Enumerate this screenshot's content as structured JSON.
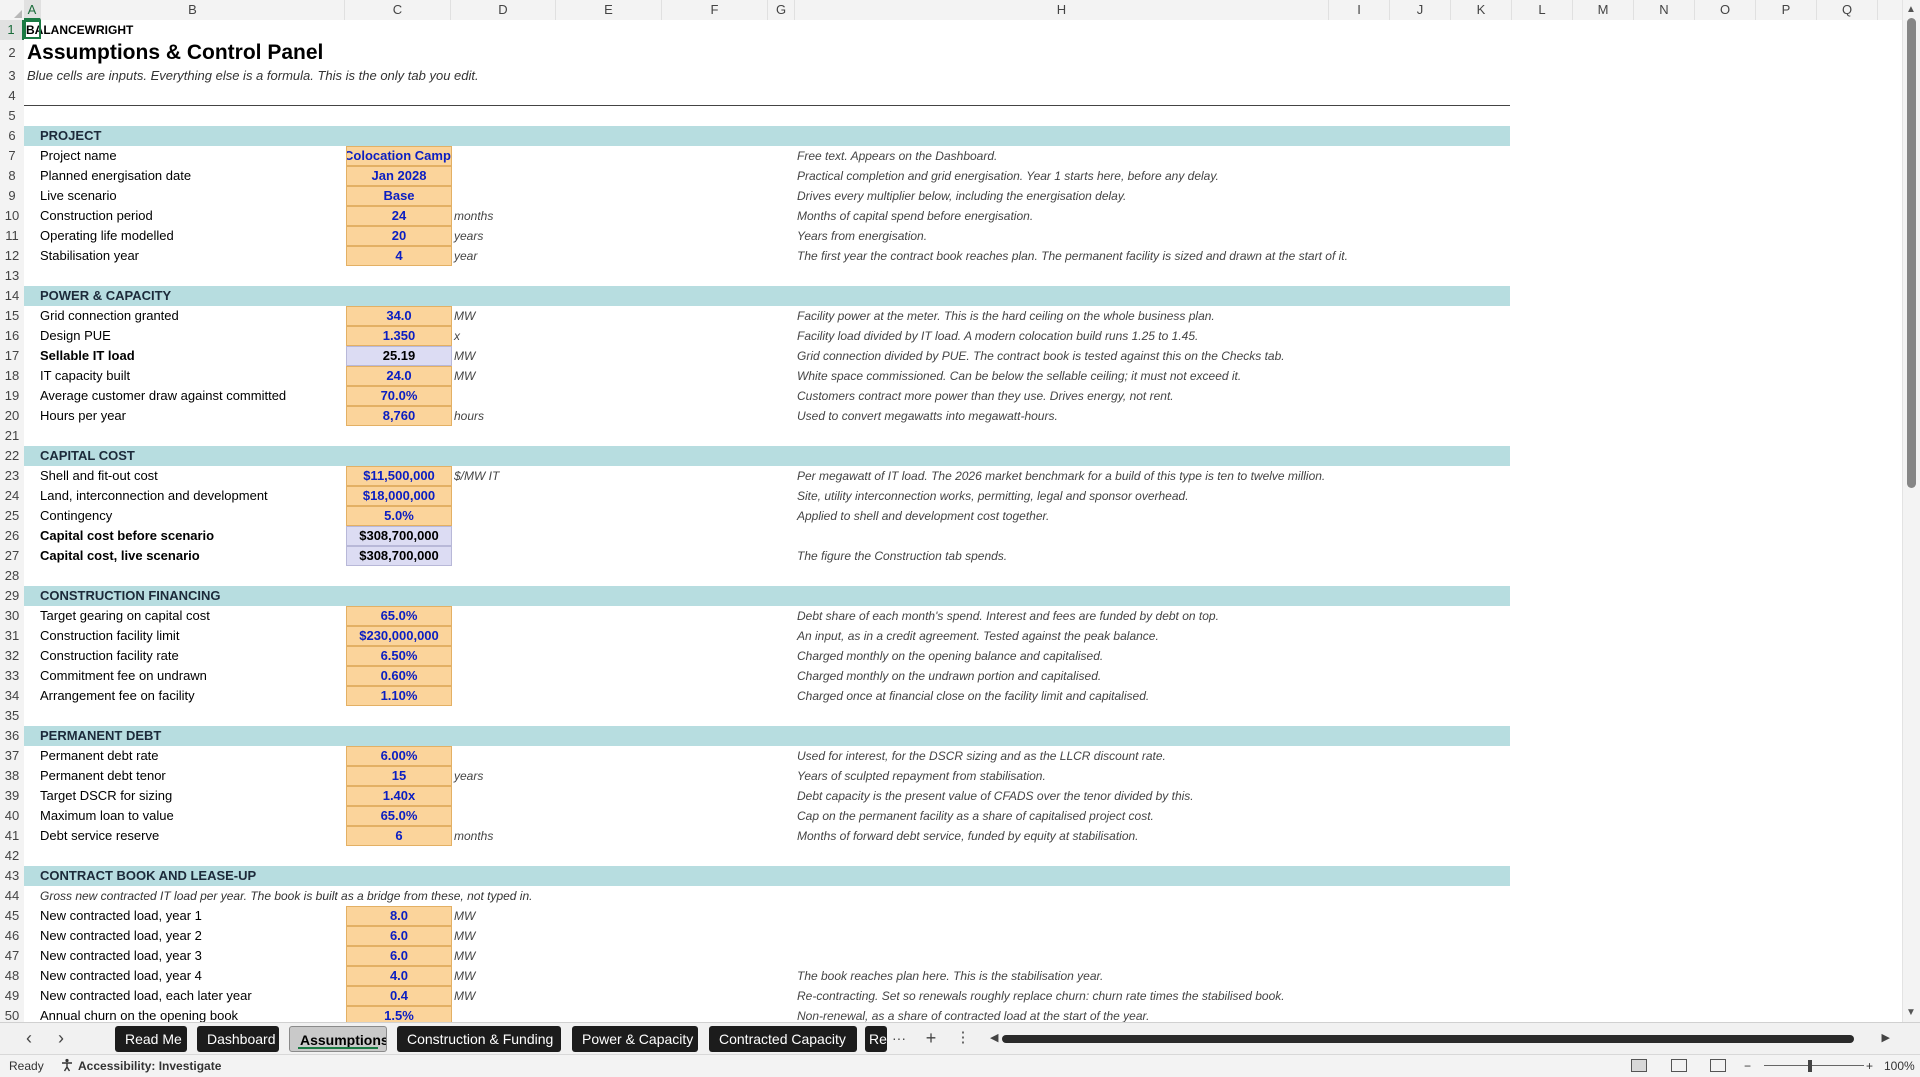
{
  "columns": [
    "A",
    "B",
    "C",
    "D",
    "E",
    "F",
    "G",
    "H",
    "I",
    "J",
    "K",
    "L",
    "M",
    "N",
    "O",
    "P",
    "Q"
  ],
  "active_column": "A",
  "active_row": "1",
  "rows": [
    "1",
    "2",
    "3",
    "4",
    "5",
    "6",
    "7",
    "8",
    "9",
    "10",
    "11",
    "12",
    "13",
    "14",
    "15",
    "16",
    "17",
    "18",
    "19",
    "20",
    "21",
    "22",
    "23",
    "24",
    "25",
    "26",
    "27",
    "28",
    "29",
    "30",
    "31",
    "32",
    "33",
    "34",
    "35",
    "36",
    "37",
    "38",
    "39",
    "40",
    "41",
    "42",
    "43",
    "44",
    "45",
    "46",
    "47",
    "48",
    "49",
    "50"
  ],
  "header": {
    "brand": "BALANCEWRIGHT",
    "title": "Assumptions & Control Panel",
    "subtitle": "Blue cells are inputs. Everything else is a formula. This is the only tab you edit."
  },
  "sections": {
    "project": "PROJECT",
    "power": "POWER & CAPACITY",
    "capital": "CAPITAL COST",
    "construction": "CONSTRUCTION FINANCING",
    "permanent": "PERMANENT DEBT",
    "contract": "CONTRACT BOOK AND LEASE-UP"
  },
  "contract_note": "Gross new contracted IT load per year. The book is built as a bridge from these, not typed in.",
  "lines": {
    "r7": {
      "label": "Project name",
      "value": "Colocation Campus - Phase I",
      "unit": "",
      "note": "Free text. Appears on the Dashboard."
    },
    "r8": {
      "label": "Planned energisation date",
      "value": "Jan 2028",
      "unit": "",
      "note": "Practical completion and grid energisation. Year 1 starts here, before any delay."
    },
    "r9": {
      "label": "Live scenario",
      "value": "Base",
      "unit": "",
      "note": "Drives every multiplier below, including the energisation delay."
    },
    "r10": {
      "label": "Construction period",
      "value": "24",
      "unit": "months",
      "note": "Months of capital spend before energisation."
    },
    "r11": {
      "label": "Operating life modelled",
      "value": "20",
      "unit": "years",
      "note": "Years from energisation."
    },
    "r12": {
      "label": "Stabilisation year",
      "value": "4",
      "unit": "year",
      "note": "The first year the contract book reaches plan. The permanent facility is sized and drawn at the start of it."
    },
    "r15": {
      "label": "Grid connection granted",
      "value": "34.0",
      "unit": "MW",
      "note": "Facility power at the meter. This is the hard ceiling on the whole business plan."
    },
    "r16": {
      "label": "Design PUE",
      "value": "1.350",
      "unit": "x",
      "note": "Facility load divided by IT load. A modern colocation build runs 1.25 to 1.45."
    },
    "r17": {
      "label": "Sellable IT load",
      "value": "25.19",
      "unit": "MW",
      "note": "Grid connection divided by PUE. The contract book is tested against this on the Checks tab."
    },
    "r18": {
      "label": "IT capacity built",
      "value": "24.0",
      "unit": "MW",
      "note": "White space commissioned. Can be below the sellable ceiling; it must not exceed it."
    },
    "r19": {
      "label": "Average customer draw against committed",
      "value": "70.0%",
      "unit": "",
      "note": "Customers contract more power than they use. Drives energy, not rent."
    },
    "r20": {
      "label": "Hours per year",
      "value": "8,760",
      "unit": "hours",
      "note": "Used to convert megawatts into megawatt-hours."
    },
    "r23": {
      "label": "Shell and fit-out cost",
      "value": "$11,500,000",
      "unit": "$/MW IT",
      "note": "Per megawatt of IT load. The 2026 market benchmark for a build of this type is ten to twelve million."
    },
    "r24": {
      "label": "Land, interconnection and development",
      "value": "$18,000,000",
      "unit": "",
      "note": "Site, utility interconnection works, permitting, legal and sponsor overhead."
    },
    "r25": {
      "label": "Contingency",
      "value": "5.0%",
      "unit": "",
      "note": "Applied to shell and development cost together."
    },
    "r26": {
      "label": "Capital cost before scenario",
      "value": "$308,700,000",
      "unit": "",
      "note": ""
    },
    "r27": {
      "label": "Capital cost, live scenario",
      "value": "$308,700,000",
      "unit": "",
      "note": "The figure the Construction tab spends."
    },
    "r30": {
      "label": "Target gearing on capital cost",
      "value": "65.0%",
      "unit": "",
      "note": "Debt share of each month's spend. Interest and fees are funded by debt on top."
    },
    "r31": {
      "label": "Construction facility limit",
      "value": "$230,000,000",
      "unit": "",
      "note": "An input, as in a credit agreement. Tested against the peak balance."
    },
    "r32": {
      "label": "Construction facility rate",
      "value": "6.50%",
      "unit": "",
      "note": "Charged monthly on the opening balance and capitalised."
    },
    "r33": {
      "label": "Commitment fee on undrawn",
      "value": "0.60%",
      "unit": "",
      "note": "Charged monthly on the undrawn portion and capitalised."
    },
    "r34": {
      "label": "Arrangement fee on facility",
      "value": "1.10%",
      "unit": "",
      "note": "Charged once at financial close on the facility limit and capitalised."
    },
    "r37": {
      "label": "Permanent debt rate",
      "value": "6.00%",
      "unit": "",
      "note": "Used for interest, for the DSCR sizing and as the LLCR discount rate."
    },
    "r38": {
      "label": "Permanent debt tenor",
      "value": "15",
      "unit": "years",
      "note": "Years of sculpted repayment from stabilisation."
    },
    "r39": {
      "label": "Target DSCR for sizing",
      "value": "1.40x",
      "unit": "",
      "note": "Debt capacity is the present value of CFADS over the tenor divided by this."
    },
    "r40": {
      "label": "Maximum loan to value",
      "value": "65.0%",
      "unit": "",
      "note": "Cap on the permanent facility as a share of capitalised project cost."
    },
    "r41": {
      "label": "Debt service reserve",
      "value": "6",
      "unit": "months",
      "note": "Months of forward debt service, funded by equity at stabilisation."
    },
    "r45": {
      "label": "New contracted load, year 1",
      "value": "8.0",
      "unit": "MW",
      "note": ""
    },
    "r46": {
      "label": "New contracted load, year 2",
      "value": "6.0",
      "unit": "MW",
      "note": ""
    },
    "r47": {
      "label": "New contracted load, year 3",
      "value": "6.0",
      "unit": "MW",
      "note": ""
    },
    "r48": {
      "label": "New contracted load, year 4",
      "value": "4.0",
      "unit": "MW",
      "note": "The book reaches plan here. This is the stabilisation year."
    },
    "r49": {
      "label": "New contracted load, each later year",
      "value": "0.4",
      "unit": "MW",
      "note": "Re-contracting. Set so renewals roughly replace churn: churn rate times the stabilised book."
    },
    "r50": {
      "label": "Annual churn on the opening book",
      "value": "1.5%",
      "unit": "",
      "note": "Non-renewal, as a share of contracted load at the start of the year."
    }
  },
  "sheet_tabs": [
    "Read Me",
    "Dashboard",
    "Assumptions",
    "Construction & Funding",
    "Power & Capacity",
    "Contracted Capacity",
    "Re"
  ],
  "active_tab": "Assumptions",
  "tab_controls": {
    "prev": "‹",
    "next": "›",
    "more": "···",
    "add": "+",
    "menu": "⋮"
  },
  "status": {
    "ready": "Ready",
    "accessibility": "Accessibility: Investigate",
    "zoom_minus": "−",
    "zoom_plus": "+",
    "zoom": "100%"
  },
  "icons": {
    "tab_prev": "chevron-left-icon",
    "tab_next": "chevron-right-icon",
    "accessibility": "accessibility-icon",
    "normal_view": "normal-view-icon",
    "page_layout": "page-layout-icon",
    "page_break": "page-break-icon"
  },
  "colors": {
    "input_fill": "#fbd49b",
    "input_text": "#0b1ec2",
    "calc_fill": "#dcdcf3",
    "section_fill": "#b7dde0",
    "accent_green": "#1a7a43"
  }
}
